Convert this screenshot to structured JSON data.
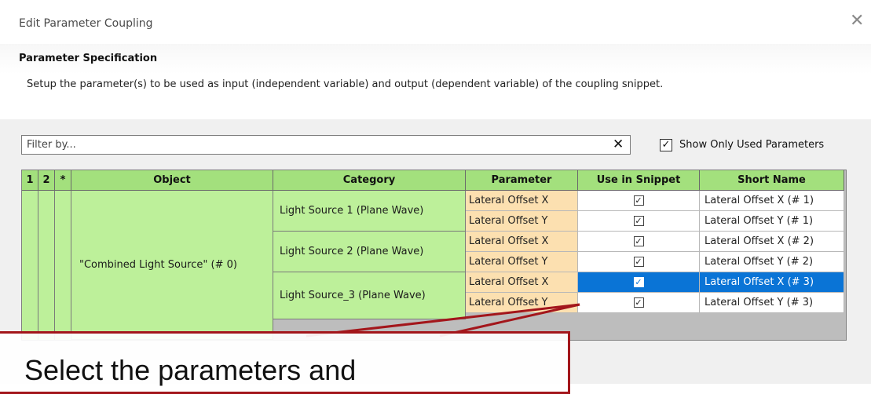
{
  "window": {
    "title": "Edit Parameter Coupling",
    "close_glyph": "✕"
  },
  "header": {
    "title": "Parameter Specification",
    "description": "Setup the parameter(s) to be used as input (independent variable) and output (dependent variable) of the coupling snippet."
  },
  "filter": {
    "placeholder": "Filter by...",
    "value": "",
    "clear_glyph": "✕"
  },
  "show_only_used": {
    "label": "Show Only Used Parameters",
    "checked": true,
    "check_glyph": "✓"
  },
  "grid": {
    "columns": [
      "1",
      "2",
      "*",
      "Object",
      "Category",
      "Parameter",
      "Use in Snippet",
      "Short Name"
    ],
    "object": "\"Combined Light Source\" (# 0)",
    "categories": [
      "Light Source 1 (Plane Wave)",
      "Light Source 2 (Plane Wave)",
      "Light Source_3 (Plane Wave)"
    ],
    "rows": [
      {
        "parameter": "Lateral Offset X",
        "use": "✓",
        "short_name": "Lateral Offset X (# 1)",
        "selected": false
      },
      {
        "parameter": "Lateral Offset Y",
        "use": "✓",
        "short_name": "Lateral Offset Y (# 1)",
        "selected": false
      },
      {
        "parameter": "Lateral Offset X",
        "use": "✓",
        "short_name": "Lateral Offset X (# 2)",
        "selected": false
      },
      {
        "parameter": "Lateral Offset Y",
        "use": "✓",
        "short_name": "Lateral Offset Y (# 2)",
        "selected": false
      },
      {
        "parameter": "Lateral Offset X",
        "use": "✓",
        "short_name": "Lateral Offset X (# 3)",
        "selected": true
      },
      {
        "parameter": "Lateral Offset Y",
        "use": "✓",
        "short_name": "Lateral Offset Y (# 3)",
        "selected": false
      }
    ]
  },
  "callout": {
    "text": "Select the parameters and",
    "border_color": "#a3161b"
  },
  "colors": {
    "header_green": "#a3e07d",
    "cell_green": "#bdf09a",
    "parameter_orange": "#fce0b0",
    "selection_blue": "#0a74d6"
  }
}
